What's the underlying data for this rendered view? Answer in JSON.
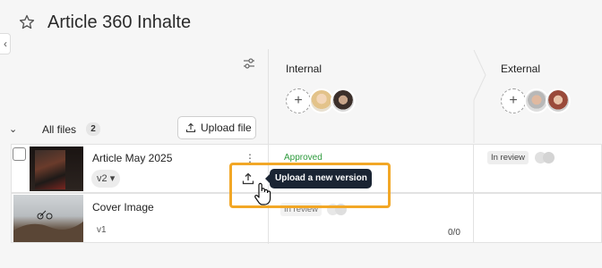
{
  "header": {
    "title": "Article 360 Inhalte",
    "star_icon": "star-icon"
  },
  "sidebar_toggle": {
    "glyph": "‹"
  },
  "files_panel": {
    "toggle_glyph": "⌄",
    "all_files_label": "All files",
    "count": "2",
    "upload_button_label": "Upload file"
  },
  "columns": [
    {
      "label": "Internal",
      "add_glyph": "+"
    },
    {
      "label": "External",
      "add_glyph": "+"
    }
  ],
  "files": [
    {
      "name": "Article May 2025",
      "version": "v2",
      "version_caret": "▾",
      "menu_glyph": "⋮",
      "internal_status": "Approved",
      "external_status": "In review"
    },
    {
      "name": "Cover Image",
      "version": "v1",
      "internal_status": "In review",
      "comments": "0/0"
    }
  ],
  "tooltip": {
    "text": "Upload a new version"
  },
  "colors": {
    "approved": "#2e9b3d",
    "highlight": "#f2a726",
    "tooltip_bg": "#1a2433"
  }
}
